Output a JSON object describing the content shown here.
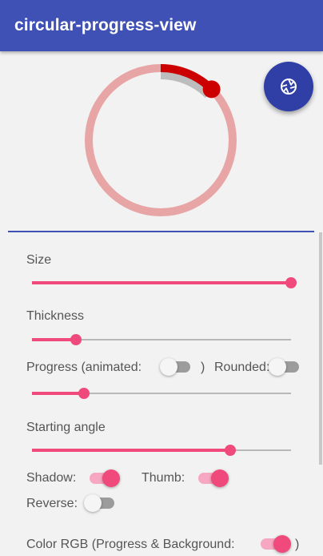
{
  "app": {
    "title": "circular-progress-view"
  },
  "progress_view": {
    "progress_percent": 12.5,
    "progress_color": "#cc0000",
    "background_color": "#e8a5a5",
    "shadow": true,
    "thumb": true
  },
  "fab": {
    "icon": "camera-shutter-icon",
    "color": "#2f3fa6"
  },
  "controls": {
    "size": {
      "label": "Size",
      "value_fraction": 1.0
    },
    "thickness": {
      "label": "Thickness",
      "value_fraction": 0.17
    },
    "progress": {
      "label": "Progress (animated:",
      "close_paren": ")",
      "animated": false,
      "rounded_label": "Rounded:",
      "rounded": false,
      "value_fraction": 0.2
    },
    "starting_angle": {
      "label": "Starting angle",
      "value_fraction": 0.765
    },
    "shadow": {
      "label": "Shadow:",
      "on": true
    },
    "thumb": {
      "label": "Thumb:",
      "on": true
    },
    "reverse": {
      "label": "Reverse:",
      "on": false
    },
    "color": {
      "label": "Color RGB (Progress & Background:",
      "close_paren": ")",
      "on": true
    }
  },
  "colors": {
    "accent": "#f04a7d",
    "primary": "#3f51b5"
  }
}
